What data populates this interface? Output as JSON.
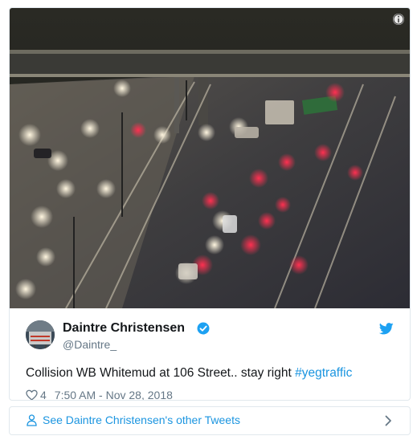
{
  "tweet": {
    "author_name": "Daintre Christensen",
    "handle": "@Daintre_",
    "text_prefix": "Collision WB Whitemud at 106 Street.. stay right ",
    "hashtag": "#yegtraffic",
    "likes": "4",
    "timestamp": "7:50 AM - Nov 28, 2018"
  },
  "footer": {
    "link_label": "See Daintre Christensen's other Tweets"
  },
  "icons": {
    "info": "info-icon",
    "verified": "verified-badge-icon",
    "bird": "twitter-bird-icon",
    "heart": "heart-icon",
    "person": "person-icon",
    "chevron": "chevron-right-icon"
  },
  "colors": {
    "link_blue": "#1b95e0",
    "text": "#14171a",
    "muted": "#657786",
    "border": "#e1e8ed"
  }
}
